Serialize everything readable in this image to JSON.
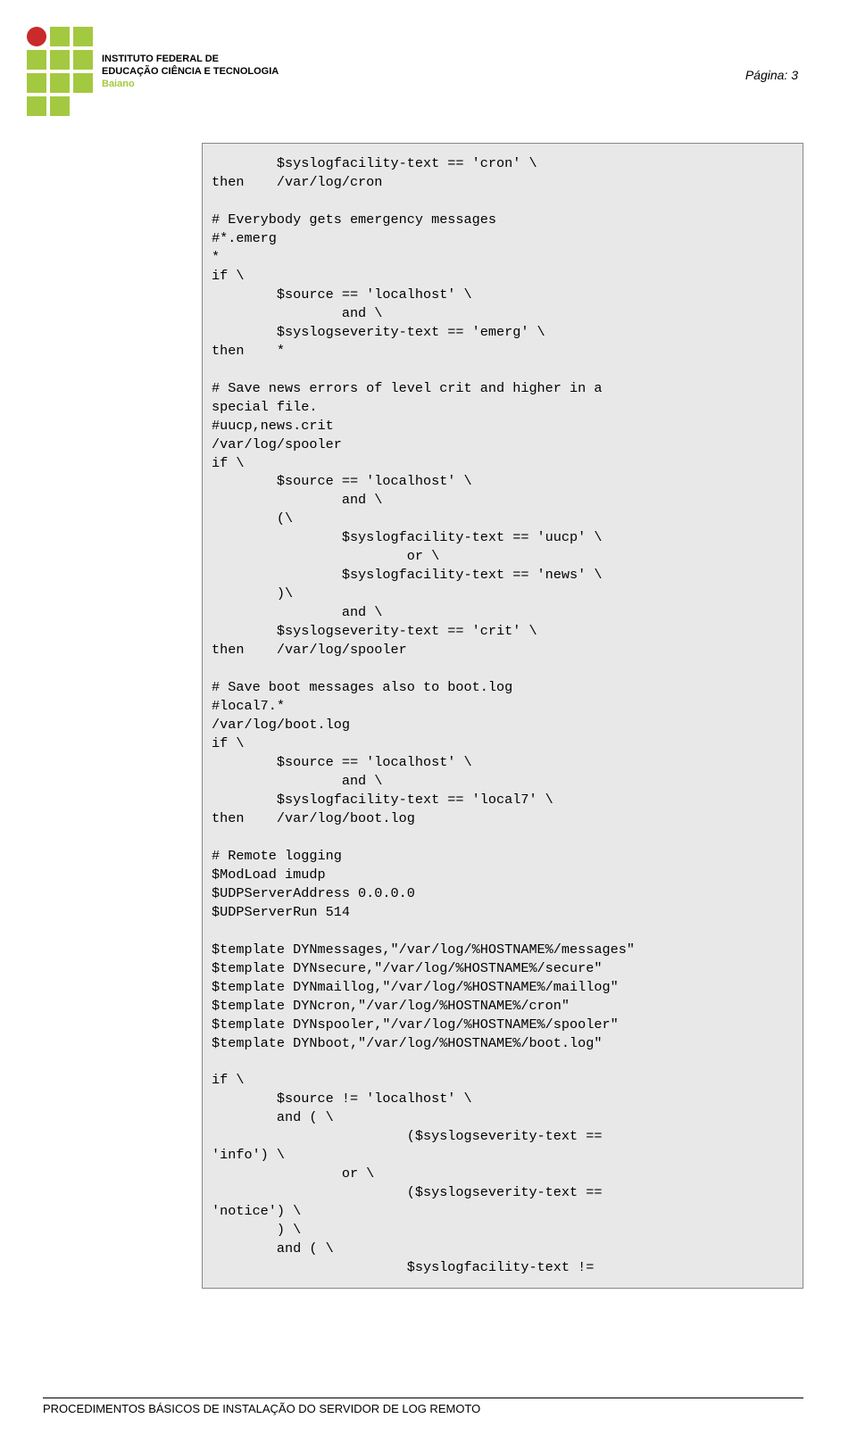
{
  "header": {
    "institute_line1": "INSTITUTO FEDERAL DE",
    "institute_line2": "EDUCAÇÃO CIÊNCIA E TECNOLOGIA",
    "institute_line3": "Baiano",
    "page_label": "Página: 3"
  },
  "code": "        $syslogfacility-text == 'cron' \\\nthen    /var/log/cron\n\n# Everybody gets emergency messages\n#*.emerg\n*\nif \\\n        $source == 'localhost' \\\n                and \\\n        $syslogseverity-text == 'emerg' \\\nthen    *\n\n# Save news errors of level crit and higher in a\nspecial file.\n#uucp,news.crit\n/var/log/spooler\nif \\\n        $source == 'localhost' \\\n                and \\\n        (\\\n                $syslogfacility-text == 'uucp' \\\n                        or \\\n                $syslogfacility-text == 'news' \\\n        )\\\n                and \\\n        $syslogseverity-text == 'crit' \\\nthen    /var/log/spooler\n\n# Save boot messages also to boot.log\n#local7.*\n/var/log/boot.log\nif \\\n        $source == 'localhost' \\\n                and \\\n        $syslogfacility-text == 'local7' \\\nthen    /var/log/boot.log\n\n# Remote logging\n$ModLoad imudp\n$UDPServerAddress 0.0.0.0\n$UDPServerRun 514\n\n$template DYNmessages,\"/var/log/%HOSTNAME%/messages\"\n$template DYNsecure,\"/var/log/%HOSTNAME%/secure\"\n$template DYNmaillog,\"/var/log/%HOSTNAME%/maillog\"\n$template DYNcron,\"/var/log/%HOSTNAME%/cron\"\n$template DYNspooler,\"/var/log/%HOSTNAME%/spooler\"\n$template DYNboot,\"/var/log/%HOSTNAME%/boot.log\"\n\nif \\\n        $source != 'localhost' \\\n        and ( \\\n                        ($syslogseverity-text ==\n'info') \\\n                or \\\n                        ($syslogseverity-text ==\n'notice') \\\n        ) \\\n        and ( \\\n                        $syslogfacility-text !=",
  "footer": {
    "text": "PROCEDIMENTOS BÁSICOS DE INSTALAÇÃO DO SERVIDOR DE LOG REMOTO"
  }
}
